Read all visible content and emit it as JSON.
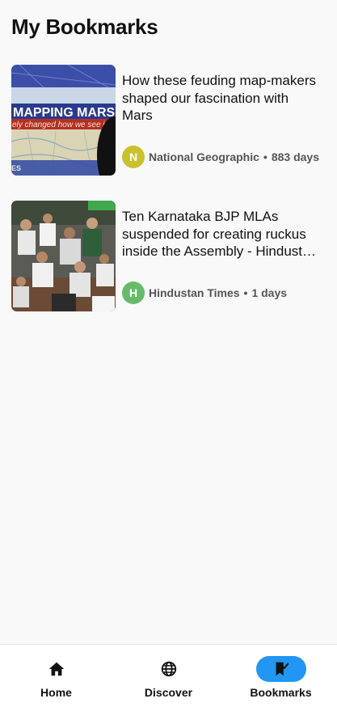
{
  "header": {
    "title": "My Bookmarks"
  },
  "bookmarks": [
    {
      "title": "How these feuding map-makers shaped our fascination with Mars",
      "source": "National Geographic",
      "source_initial": "N",
      "avatar_color": "#c9c12e",
      "age": "883 days",
      "thumb_text_1": "MAPPING MARS",
      "thumb_text_2": "ely changed how we see it",
      "thumb_text_3": "ES"
    },
    {
      "title": "Ten Karnataka BJP MLAs suspended for creating ruckus inside the Assembly - Hindustan Times",
      "source": "Hindustan Times",
      "source_initial": "H",
      "avatar_color": "#66bb6a",
      "age": "1 days"
    }
  ],
  "separator": "•",
  "nav": {
    "items": [
      {
        "label": "Home",
        "icon": "home-icon",
        "active": false
      },
      {
        "label": "Discover",
        "icon": "globe-icon",
        "active": false
      },
      {
        "label": "Bookmarks",
        "icon": "bookmark-check-icon",
        "active": true
      }
    ],
    "active_color": "#2196f3"
  }
}
